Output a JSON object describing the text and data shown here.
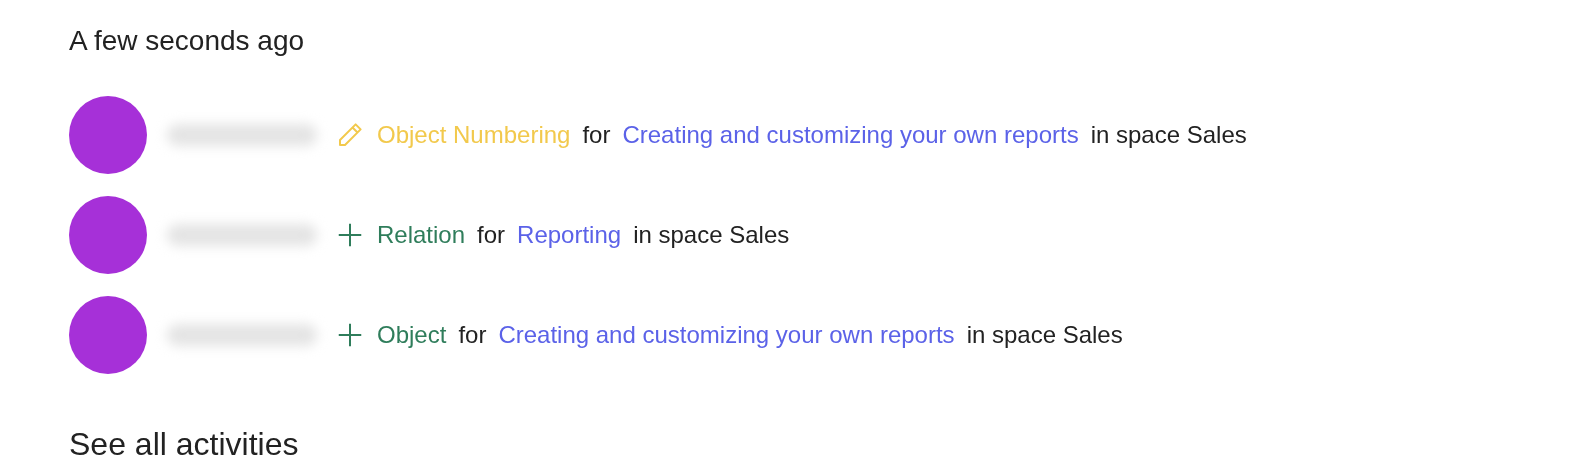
{
  "heading": "A few seconds ago",
  "activities": [
    {
      "kind": "edit",
      "item": "Object Numbering",
      "for": "for",
      "target": "Creating and customizing your own reports",
      "suffix": "in space Sales"
    },
    {
      "kind": "add",
      "item": "Relation",
      "for": "for",
      "target": "Reporting",
      "suffix": "in space Sales"
    },
    {
      "kind": "add",
      "item": "Object",
      "for": "for",
      "target": "Creating and customizing your own reports",
      "suffix": "in space Sales"
    }
  ],
  "footer_link": "See all activities"
}
